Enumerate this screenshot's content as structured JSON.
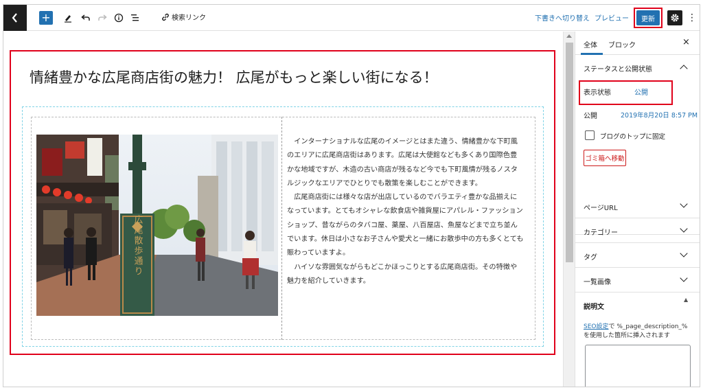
{
  "toolbar": {
    "link_label": "検索リンク",
    "switch_draft": "下書きへ切り替え",
    "preview": "プレビュー",
    "update": "更新"
  },
  "editor": {
    "post_title": "情緒豊かな広尾商店街の魅力！ 広尾がもっと楽しい街になる！",
    "paragraphs": [
      "インターナショナルな広尾のイメージとはまた違う、情緒豊かな下町風のエリアに広尾商店街はあります。広尾は大使館なども多くあり国際色豊かな地域ですが、木造の古い商店が残るなど今でも下町風情が残るノスタルジックなエリアでひとりでも散策を楽しむことができます。",
      "広尾商店街には様々な店が出店しているのでバラエティ豊かな品揃えになっています。とてもオシャレな飲食店や雑貨屋にアパレル・ファッションショップ、昔ながらのタバコ屋、薬屋、八百屋店、魚屋などまで立ち並んでいます。休日は小さなお子さんや愛犬と一緒にお散歩中の方も多くとても賑わっていますよ。",
      "ハイソな雰囲気ながらもどこかほっこりとする広尾商店街。その特徴や魅力を紹介していきます。"
    ],
    "image_sign_text": "広尾散歩通り"
  },
  "sidebar": {
    "tab_document": "全体",
    "tab_block": "ブロック",
    "status_section": "ステータスと公開状態",
    "visibility_label": "表示状態",
    "visibility_value": "公開",
    "publish_label": "公開",
    "publish_value": "2019年8月20日 8:57 PM",
    "sticky_label": "ブログのトップに固定",
    "trash_button": "ゴミ箱へ移動",
    "permalink_section": "ページURL",
    "categories_section": "カテゴリー",
    "tags_section": "タグ",
    "featured_image_section": "一覧画像",
    "description_section": "説明文",
    "description_help_link": "SEO設定",
    "description_help_text": "で %_page_description_% を使用した箇所に挿入されます"
  },
  "colors": {
    "accent": "#2271b1",
    "highlight_red": "#e0001a",
    "danger": "#cc1818"
  }
}
